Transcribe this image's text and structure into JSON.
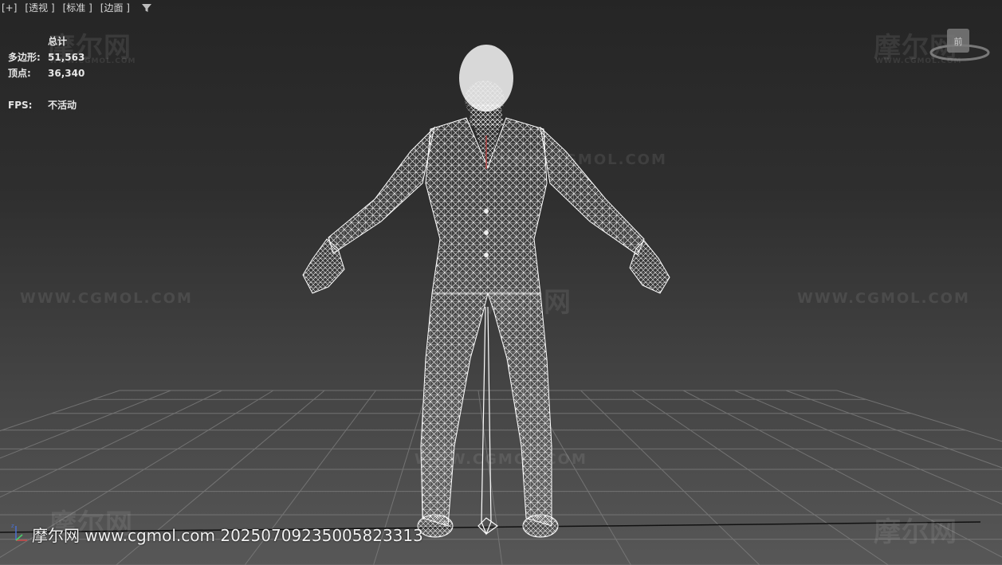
{
  "viewport": {
    "labels": [
      "[+]",
      "[透视 ]",
      "[标准 ]",
      "[边面 ]"
    ]
  },
  "stats": {
    "header": "总计",
    "polygons_label": "多边形:",
    "polygons_value": "51,563",
    "vertices_label": "顶点:",
    "vertices_value": "36,340",
    "fps_label": "FPS:",
    "fps_value": "不活动"
  },
  "watermark": {
    "site": "WWW.CGMOL.COM",
    "logo": "摩尔网",
    "small": "WWW.CGMOL.COM"
  },
  "caption": "摩尔网 www.cgmol.com 20250709235005823313",
  "colors": {
    "background_top": "#252525",
    "background_bottom": "#575757",
    "grid": "#7a7a7a",
    "wireframe": "#ffffff"
  },
  "icons": [
    "filter-icon",
    "viewcube-icon",
    "axis-gizmo-icon"
  ]
}
